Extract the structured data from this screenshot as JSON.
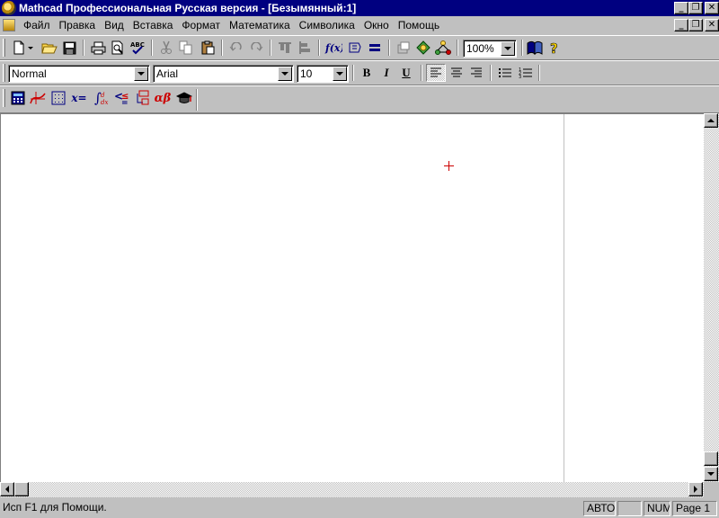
{
  "window": {
    "title": "Mathcad Профессиональная Русская версия - [Безымянный:1]"
  },
  "menu": [
    {
      "label": "Файл"
    },
    {
      "label": "Правка"
    },
    {
      "label": "Вид"
    },
    {
      "label": "Вставка"
    },
    {
      "label": "Формат"
    },
    {
      "label": "Математика"
    },
    {
      "label": "Символика"
    },
    {
      "label": "Окно"
    },
    {
      "label": "Помощь"
    }
  ],
  "standard_toolbar": {
    "zoom": "100%"
  },
  "format_toolbar": {
    "style": "Normal",
    "font": "Arial",
    "size": "10",
    "bold_label": "B",
    "italic_label": "I",
    "underline_label": "U"
  },
  "math_toolbar": {
    "eval_label": "x=",
    "greek_label": "αβ"
  },
  "status": {
    "help_text": "Исп F1 для Помощи.",
    "mode": "АВТО",
    "blank": "",
    "num": "NUM",
    "page": "Page 1"
  },
  "colors": {
    "titlebar": "#000080",
    "chrome": "#c0c0c0",
    "accent_red": "#cc0000"
  }
}
